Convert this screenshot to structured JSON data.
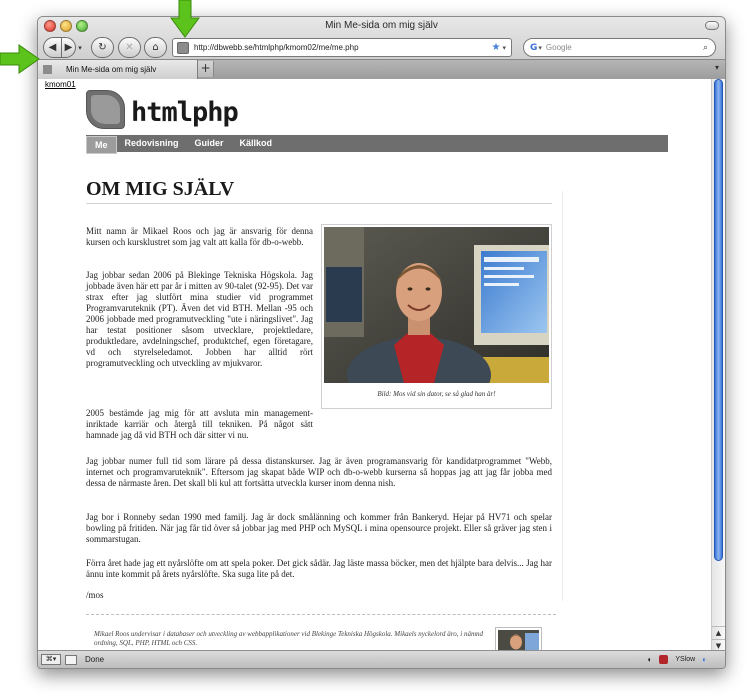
{
  "window": {
    "title": "Min Me-sida om mig själv"
  },
  "toolbar": {
    "back_glyph": "◀",
    "forward_glyph": "▶",
    "dropdown_glyph": "▾",
    "reload_glyph": "↻",
    "stop_glyph": "✕",
    "home_glyph": "⌂",
    "url": "http://dbwebb.se/htmlphp/kmom02/me/me.php",
    "star_glyph": "★",
    "search_placeholder": "Google",
    "search_engine_glyph": "G",
    "search_glyph": "⌕"
  },
  "tabs": {
    "items": [
      {
        "label": "Min Me-sida om mig själv"
      }
    ],
    "add_label": "+",
    "list_glyph": "▾"
  },
  "page": {
    "top_link": "kmom01",
    "site_title": "htmlphp",
    "nav": [
      {
        "label": "Me"
      },
      {
        "label": "Redovisning"
      },
      {
        "label": "Guider"
      },
      {
        "label": "Källkod"
      }
    ],
    "heading": "OM MIG SJÄLV",
    "figure_caption": "Bild: Mos vid sin dator, se så glad han är!",
    "paragraphs": [
      "Mitt namn är Mikael Roos och jag är ansvarig för denna kursen och kursklustret som jag valt att kalla för db-o-webb.",
      "Jag jobbar sedan 2006 på Blekinge Tekniska Högskola. Jag jobbade även här ett par år i mitten av 90-talet (92-95). Det var strax efter jag slutfört mina studier vid programmet Programvaruteknik (PT). Även det vid BTH. Mellan -95 och 2006 jobbade med programutveckling \"ute i näringslivet\". Jag har testat positioner såsom utvecklare, projektledare, produktledare, avdelningschef, produktchef, egen företagare, vd och styrelseledamot. Jobben har alltid rört programutveckling och utveckling av mjukvaror.",
      "2005 bestämde jag mig för att avsluta min management-inriktade karriär och återgå till tekniken. På något sätt hamnade jag då vid BTH och där sitter vi nu.",
      "Jag jobbar numer full tid som lärare på dessa distanskurser. Jag är även programansvarig för kandidatprogrammet \"Webb, internet och programvaruteknik\". Eftersom jag skapat både WIP och db-o-webb kurserna så hoppas jag att jag får jobba med dessa de närmaste åren. Det skall bli kul att fortsätta utveckla kurser inom denna nish.",
      "Jag bor i Ronneby sedan 1990 med familj. Jag är dock smålänning och kommer från Bankeryd. Hejar på HV71 och spelar bowling på fritiden. När jag får tid över så jobbar jag med PHP och MySQL i mina opensource projekt. Eller så gräver jag sten i sommarstugan.",
      "Förra året hade jag ett nyårslöfte om att spela poker. Det gick sådär. Jag läste massa böcker, men det hjälpte bara delvis... Jag har ännu inte kommit på årets nyårslöfte. Ska suga lite på det.",
      "/mos"
    ],
    "footer_text": "Mikael Roos undervisar i databaser och utveckling av webbapplikationer vid Blekinge Tekniska Högskola. Mikaels nyckelord äro, i nämnd ordning, SQL, PHP, HTML och CSS."
  },
  "scrollbar": {
    "up_glyph": "▲",
    "down_glyph": "▼"
  },
  "statusbar": {
    "status": "Done",
    "yslow_label": "YSlow",
    "left_glyph": "⌘▾",
    "right_glyph": "◐"
  },
  "colors": {
    "arrow_green": "#5cc21c",
    "scroll_blue": "#3a74d9",
    "navbar_gray": "#6e6e6e"
  }
}
